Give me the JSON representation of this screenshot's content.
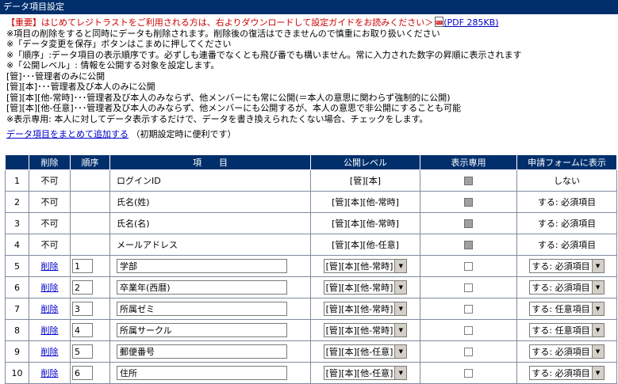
{
  "title": "データ項目設定",
  "notice": {
    "text": "【重要】はじめてレジトラストをご利用される方は、右よりダウンロードして設定ガイドをお読みください＞",
    "pdf_link": "(PDF 285KB)"
  },
  "notes": [
    "※項目の削除をすると同時にデータも削除されます。削除後の復活はできませんので慎重にお取り扱いください",
    "※「データ変更を保存」ボタンはこまめに押してください",
    "※「順序」:データ項目の表示順序です。必ずしも連番でなくとも飛び番でも構いません。常に入力された数字の昇順に表示されます",
    "※「公開レベル」: 情報を公開する対象を設定します。",
    "[管]･･･管理者のみに公開",
    "[管][本]･･･管理者及び本人のみに公開",
    "[管][本][他-常時]･･･管理者及び本人のみならず、他メンバーにも常に公開(＝本人の意思に関わらず強制的に公開)",
    "[管][本][他-任意]･･･管理者及び本人のみならず、他メンバーにも公開するが、本人の意思で非公開にすることも可能",
    "※表示専用: 本人に対してデータ表示するだけで、データを書き換えられたくない場合、チェックをします。"
  ],
  "bulk_add": {
    "link": "データ項目をまとめて追加する",
    "hint": "（初期設定時に便利です）"
  },
  "table": {
    "headers": [
      "",
      "削除",
      "順序",
      "項　　目",
      "公開レベル",
      "表示専用",
      "申請フォームに表示"
    ],
    "rows": [
      {
        "no": "1",
        "delete": "不可",
        "order": "",
        "name": "ログインID",
        "level": "[管][本]",
        "form": "しない",
        "editable": false
      },
      {
        "no": "2",
        "delete": "不可",
        "order": "",
        "name": "氏名(姓)",
        "level": "[管][本][他-常時]",
        "form": "する: 必須項目",
        "editable": false
      },
      {
        "no": "3",
        "delete": "不可",
        "order": "",
        "name": "氏名(名)",
        "level": "[管][本][他-常時]",
        "form": "する: 必須項目",
        "editable": false
      },
      {
        "no": "4",
        "delete": "不可",
        "order": "",
        "name": "メールアドレス",
        "level": "[管][本][他-任意]",
        "form": "する: 必須項目",
        "editable": false
      },
      {
        "no": "5",
        "delete": "削除",
        "order": "1",
        "name": "学部",
        "level": "[管][本][他-常時]",
        "form": "する: 必須項目",
        "editable": true
      },
      {
        "no": "6",
        "delete": "削除",
        "order": "2",
        "name": "卒業年(西暦)",
        "level": "[管][本][他-常時]",
        "form": "する: 必須項目",
        "editable": true
      },
      {
        "no": "7",
        "delete": "削除",
        "order": "3",
        "name": "所属ゼミ",
        "level": "[管][本][他-常時]",
        "form": "する: 任意項目",
        "editable": true
      },
      {
        "no": "8",
        "delete": "削除",
        "order": "4",
        "name": "所属サークル",
        "level": "[管][本][他-常時]",
        "form": "する: 任意項目",
        "editable": true
      },
      {
        "no": "9",
        "delete": "削除",
        "order": "5",
        "name": "郵便番号",
        "level": "[管][本][他-任意]",
        "form": "する: 必須項目",
        "editable": true
      },
      {
        "no": "10",
        "delete": "削除",
        "order": "6",
        "name": "住所",
        "level": "[管][本][他-任意]",
        "form": "する: 必須項目",
        "editable": true
      }
    ]
  },
  "colors": {
    "header_bg": "#002f6c",
    "notice": "#cc0000",
    "link": "#0000cc"
  },
  "icons": {
    "pdf": "pdf-icon",
    "dropdown": "chevron-down-icon"
  }
}
